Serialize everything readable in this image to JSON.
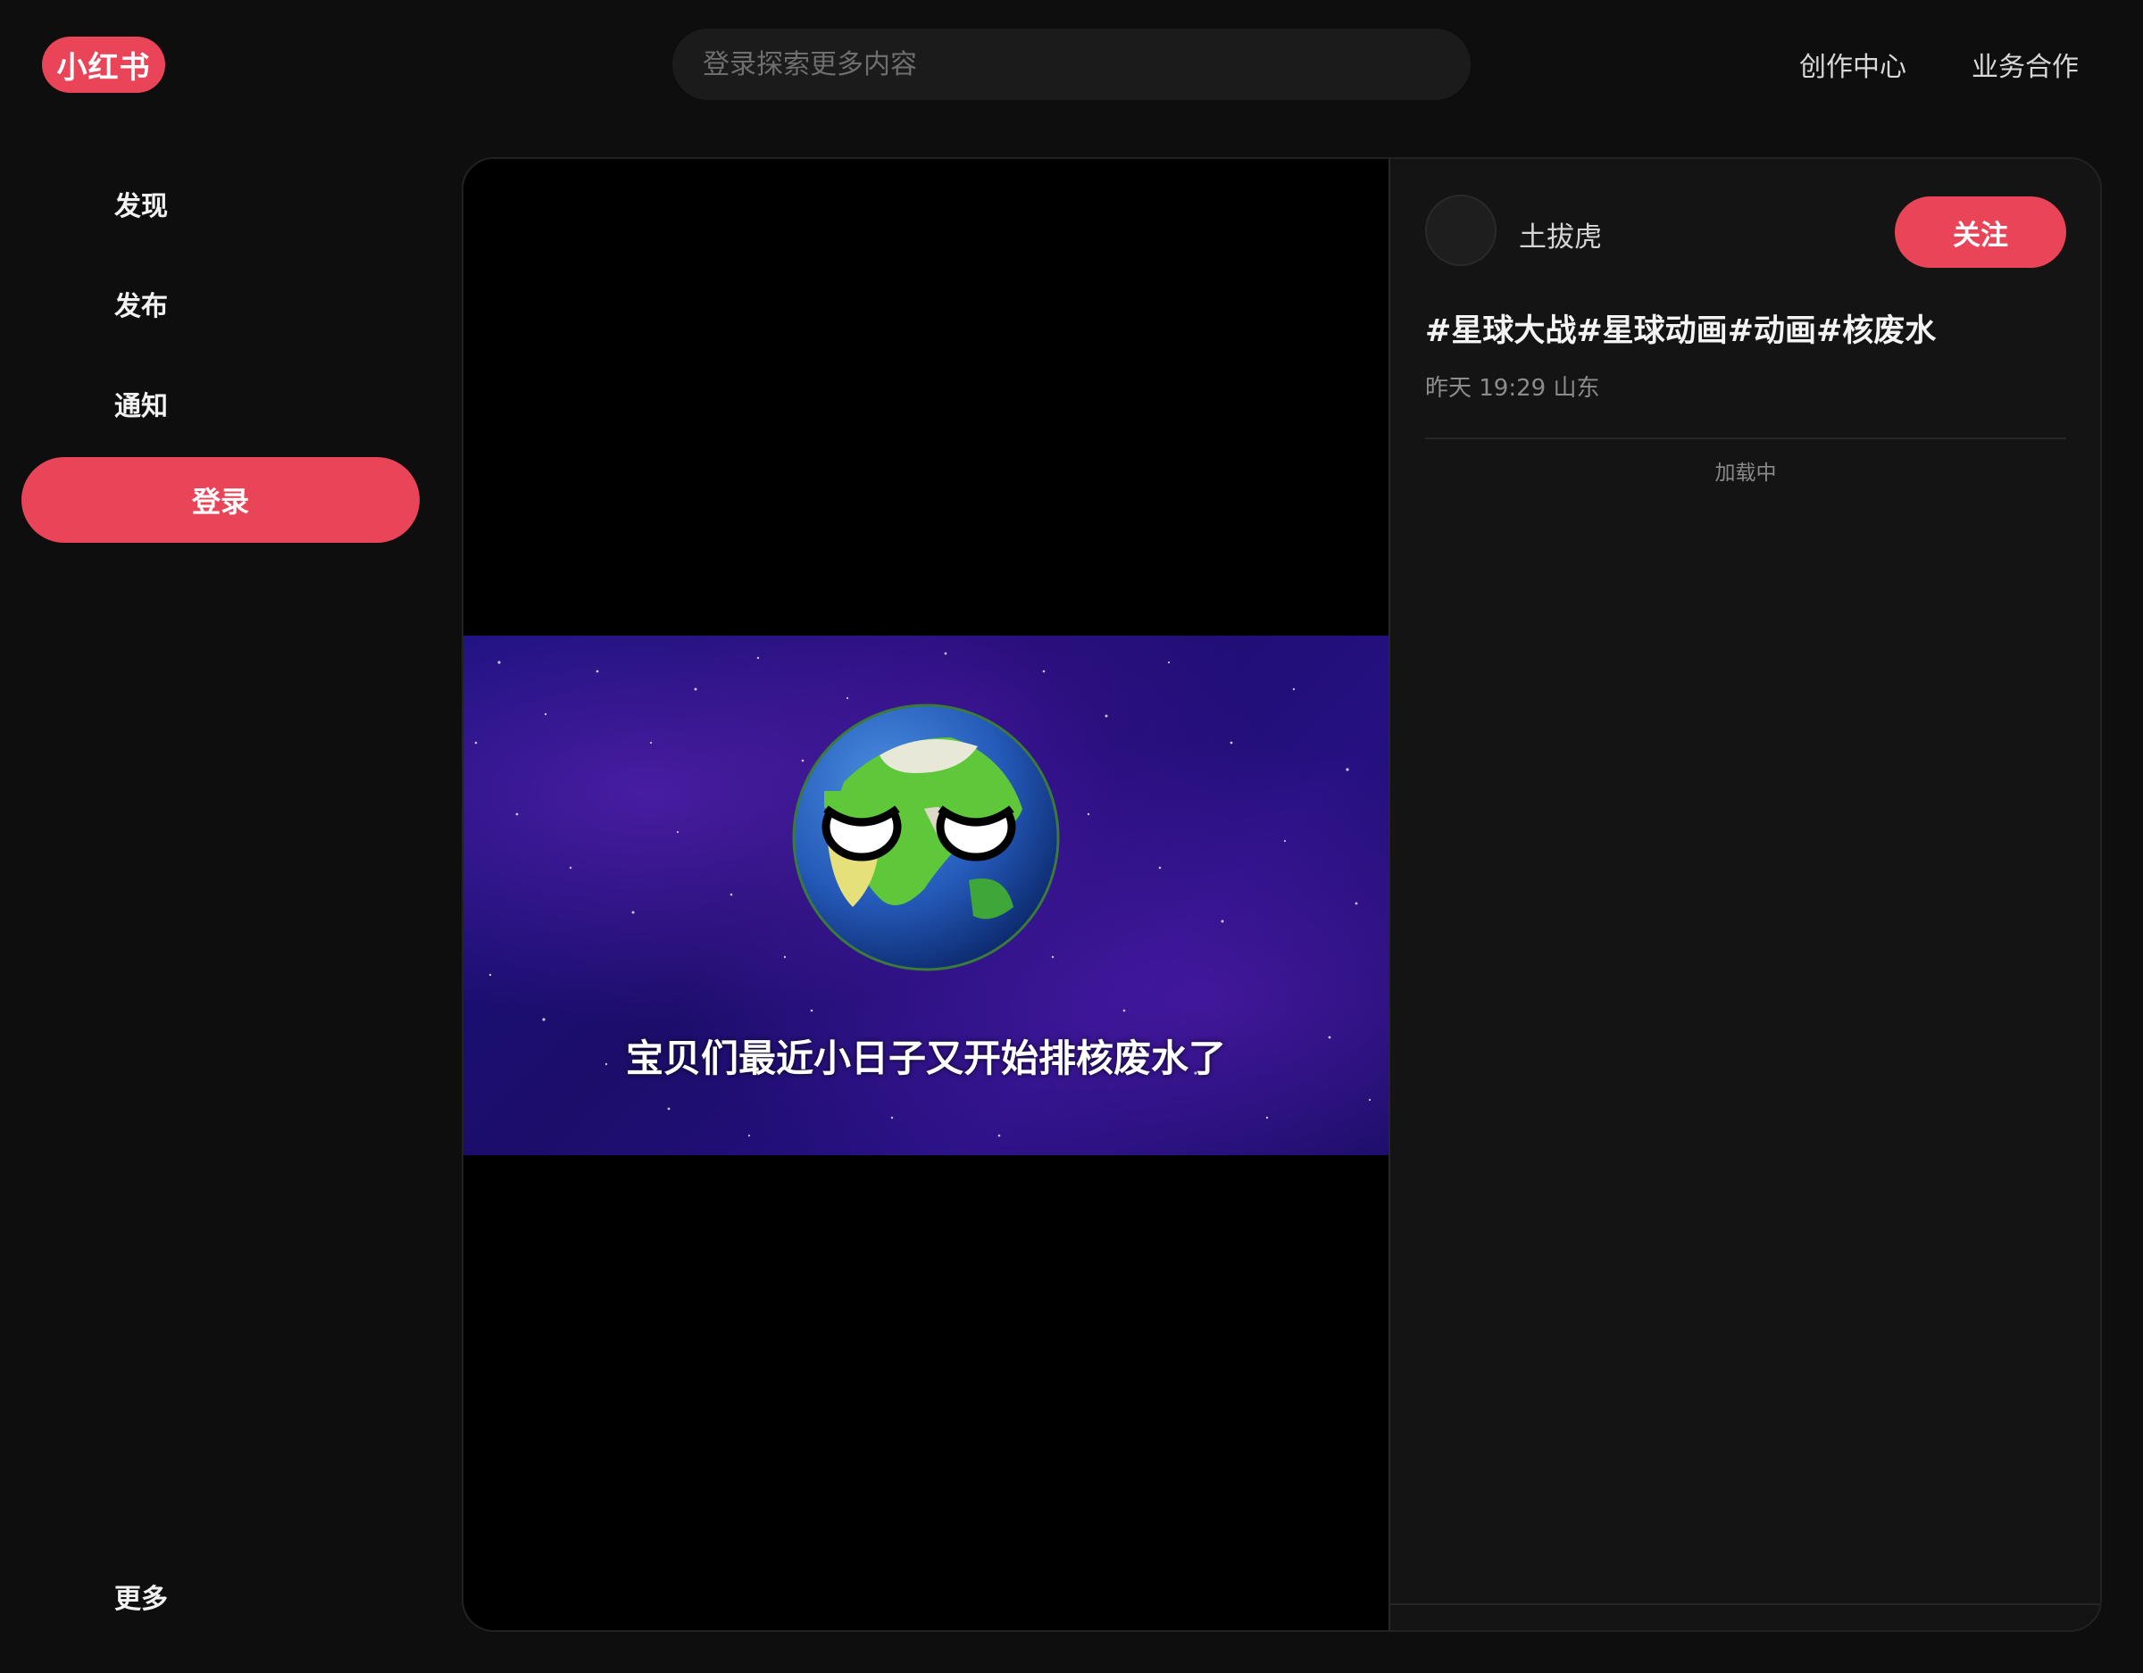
{
  "header": {
    "logo_text": "小红书",
    "search_placeholder": "登录探索更多内容",
    "links": [
      "创作中心",
      "业务合作"
    ]
  },
  "sidebar": {
    "items": [
      "发现",
      "发布",
      "通知"
    ],
    "login_label": "登录",
    "more_label": "更多"
  },
  "video": {
    "subtitle": "宝贝们最近小日子又开始排核废水了"
  },
  "note": {
    "author": "土拔虎",
    "follow_label": "关注",
    "title": "#星球大战#星球动画#动画#核废水",
    "meta": "昨天 19:29 山东",
    "loading": "加载中"
  },
  "colors": {
    "accent": "#ea4458",
    "background": "#0e0e0e",
    "panel": "#141414"
  }
}
